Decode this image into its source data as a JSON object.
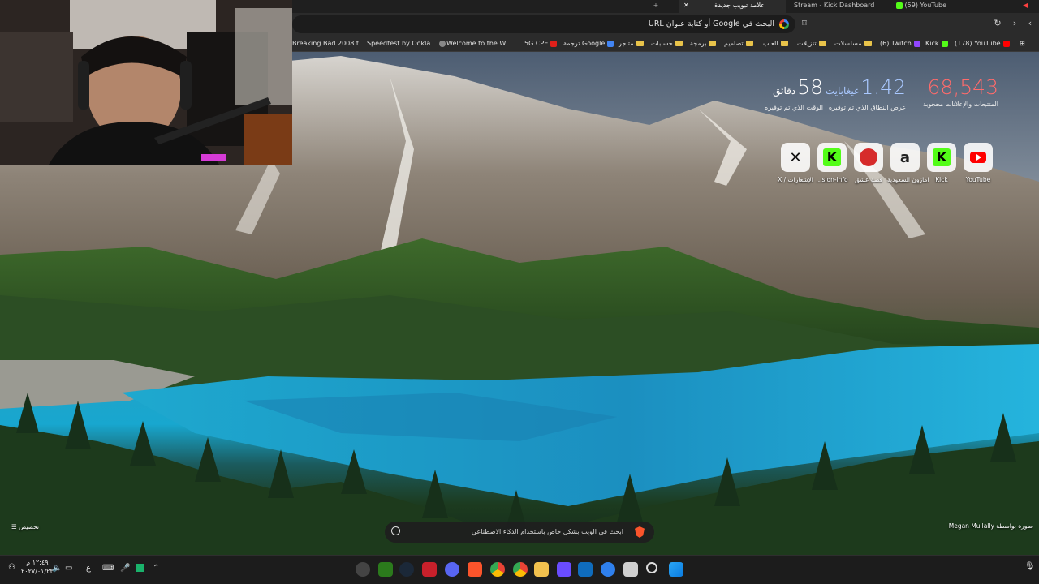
{
  "tabs": [
    {
      "label": "(59) YouTube",
      "color": "#ff0000"
    },
    {
      "label": "Stream - Kick Dashboard",
      "color": "#53fc18"
    },
    {
      "label": "علامة تبويب جديدة",
      "color": "#ff5a36",
      "active": true
    }
  ],
  "omnibox": {
    "placeholder": "البحث في Google أو كتابة عنوان URL"
  },
  "bookmarks": [
    {
      "label": "(178) YouTube",
      "kind": "youtube"
    },
    {
      "label": "Kick",
      "kind": "kick"
    },
    {
      "label": "(6) Twitch",
      "kind": "twitch"
    },
    {
      "label": "مسلسلات",
      "kind": "folder"
    },
    {
      "label": "تنزيلات",
      "kind": "folder"
    },
    {
      "label": "العاب",
      "kind": "folder"
    },
    {
      "label": "تصاميم",
      "kind": "folder"
    },
    {
      "label": "برمجة",
      "kind": "folder"
    },
    {
      "label": "حسابات",
      "kind": "folder"
    },
    {
      "label": "متاجر",
      "kind": "folder"
    },
    {
      "label": "ترجمة Google",
      "kind": "translate"
    },
    {
      "label": "5G CPE",
      "kind": "huawei"
    },
    {
      "label": "Welcome to the W...",
      "kind": "page"
    },
    {
      "label": "Speedtest by Ookla...",
      "kind": "speedtest"
    },
    {
      "label": "Breaking Bad 2008 f...",
      "kind": "page"
    }
  ],
  "stats": {
    "blocked": {
      "value": "68,543",
      "label": "المتتبعات والإعلانات محجوبة",
      "color": "#ff6b6b"
    },
    "bandwidth": {
      "value": "1.42",
      "unit": "غيغابايت",
      "label": "عرض النطاق الذي تم توفيره",
      "color": "#a9c8ff"
    },
    "time": {
      "value": "58",
      "unit": "دقائق",
      "label": "الوقت الذي تم توفيره",
      "color": "#ffffff"
    }
  },
  "top_sites": [
    {
      "label": "YouTube",
      "icon": "youtube-icon"
    },
    {
      "label": "Kick",
      "icon": "kick-icon"
    },
    {
      "label": "امازون السعودية",
      "icon": "amazon-icon"
    },
    {
      "label": "قصة عشق",
      "icon": "qissa-icon"
    },
    {
      "label": "...sion-info",
      "icon": "kick-icon"
    },
    {
      "label": "X / الإشعارات",
      "icon": "x-icon"
    }
  ],
  "ai_search": {
    "placeholder": "ابحث في الويب بشكل خاص باستخدام الذكاء الاصطناعي"
  },
  "photo_credit": "صورة بواسطة Megan Mullally",
  "customize_label": "تخصيص",
  "taskbar": {
    "time": "١٢:٤٩ م",
    "date": "٢٠٢٧/٠١/٢٣",
    "lang": "ع"
  }
}
